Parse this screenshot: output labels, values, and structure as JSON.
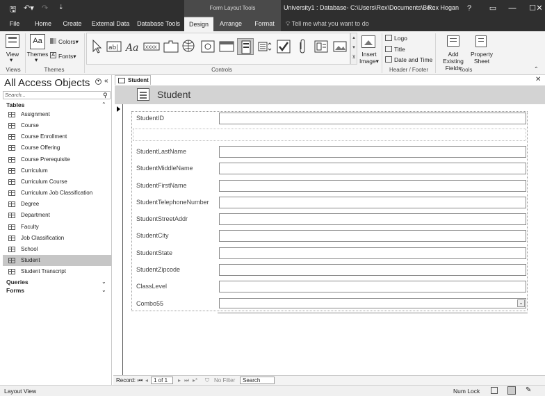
{
  "window": {
    "contextual_group": "Form Layout Tools",
    "title": "University1 : Database- C:\\Users\\Rex\\Documents\\Bo...",
    "user": "Rex Hogan",
    "help": "?",
    "minimize": "—",
    "maximize": "☐",
    "close": "✕"
  },
  "tabs": [
    {
      "label": "File"
    },
    {
      "label": "Home"
    },
    {
      "label": "Create"
    },
    {
      "label": "External Data"
    },
    {
      "label": "Database Tools"
    },
    {
      "label": "Design"
    },
    {
      "label": "Arrange"
    },
    {
      "label": "Format"
    }
  ],
  "tell_me": "Tell me what you want to do",
  "ribbon": {
    "views": {
      "view_label": "View",
      "group": "Views"
    },
    "themes": {
      "themes_label": "Themes",
      "colors_label": "Colors",
      "fonts_label": "Fonts",
      "group": "Themes"
    },
    "controls": {
      "group": "Controls"
    },
    "insert_image": "Insert Image",
    "header_footer": {
      "logo": "Logo",
      "title": "Title",
      "date_time": "Date and Time",
      "group": "Header / Footer"
    },
    "tools": {
      "add_fields": "Add Existing Fields",
      "property_sheet": "Property Sheet",
      "group": "Tools"
    }
  },
  "nav": {
    "title": "All Access Objects",
    "search_placeholder": "Search...",
    "tables_header": "Tables",
    "tables": [
      "Assignment",
      "Course",
      "Course Enrollment",
      "Course Offering",
      "Course Prerequisite",
      "Curriculum",
      "Curriculum Course",
      "Curriculum Job Classification",
      "Degree",
      "Department",
      "Faculty",
      "Job Classification",
      "School",
      "Student",
      "Student Transcript"
    ],
    "selected_table": "Student",
    "queries_header": "Queries",
    "forms_header": "Forms"
  },
  "document": {
    "tab_label": "Student",
    "form_title": "Student",
    "fields": [
      "StudentID",
      "StudentLastName",
      "StudentMiddleName",
      "StudentFirstName",
      "StudentTelephoneNumber",
      "StudentStreetAddr",
      "StudentCity",
      "StudentState",
      "StudentZipcode",
      "ClassLevel",
      "Combo55"
    ]
  },
  "record_nav": {
    "label": "Record:",
    "position": "1 of 1",
    "filter": "No Filter",
    "search": "Search"
  },
  "status": {
    "left": "Layout View",
    "num_lock": "Num Lock"
  }
}
